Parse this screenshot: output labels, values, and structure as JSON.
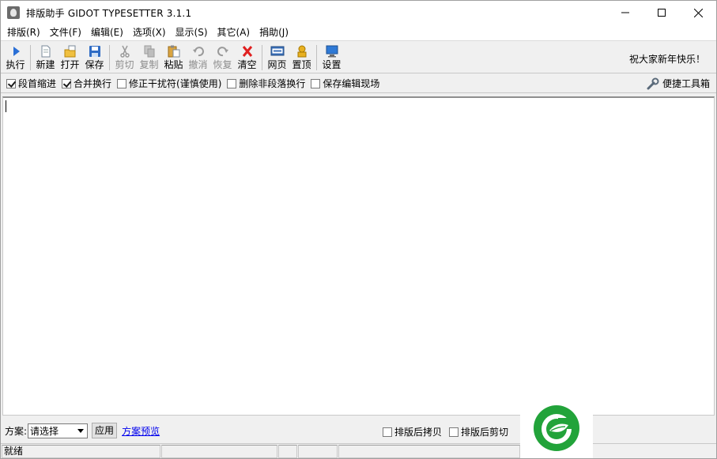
{
  "window": {
    "title": "排版助手 GIDOT TYPESETTER 3.1.1",
    "app_icon": "gidot-app-icon"
  },
  "controls": {
    "minimize": "minimize-icon",
    "maximize": "maximize-icon",
    "close": "close-icon"
  },
  "menu": [
    {
      "label": "排版(R)"
    },
    {
      "label": "文件(F)"
    },
    {
      "label": "编辑(E)"
    },
    {
      "label": "选项(X)"
    },
    {
      "label": "显示(S)"
    },
    {
      "label": "其它(A)"
    },
    {
      "label": "捐助(J)"
    }
  ],
  "toolbar": {
    "buttons": [
      {
        "label": "执行",
        "icon": "play-icon",
        "enabled": true
      },
      {
        "label": "新建",
        "icon": "new-file-icon",
        "enabled": true
      },
      {
        "label": "打开",
        "icon": "open-folder-icon",
        "enabled": true
      },
      {
        "label": "保存",
        "icon": "floppy-disk-icon",
        "enabled": true
      },
      {
        "label": "剪切",
        "icon": "scissors-icon",
        "enabled": false
      },
      {
        "label": "复制",
        "icon": "copy-icon",
        "enabled": false
      },
      {
        "label": "粘贴",
        "icon": "paste-icon",
        "enabled": true
      },
      {
        "label": "撤消",
        "icon": "undo-icon",
        "enabled": false
      },
      {
        "label": "恢复",
        "icon": "redo-icon",
        "enabled": false
      },
      {
        "label": "清空",
        "icon": "red-x-icon",
        "enabled": true
      },
      {
        "label": "网页",
        "icon": "html-icon",
        "enabled": true
      },
      {
        "label": "置顶",
        "icon": "pin-top-icon",
        "enabled": true
      },
      {
        "label": "设置",
        "icon": "monitor-settings-icon",
        "enabled": true
      }
    ],
    "greeting": "祝大家新年快乐！"
  },
  "options": {
    "items": [
      {
        "label": "段首缩进",
        "checked": true
      },
      {
        "label": "合并换行",
        "checked": true
      },
      {
        "label": "修正干扰符(谨慎使用)",
        "checked": false
      },
      {
        "label": "删除非段落换行",
        "checked": false
      },
      {
        "label": "保存编辑现场",
        "checked": false
      }
    ],
    "toolbox_label": "便捷工具箱",
    "toolbox_icon": "wrench-icon"
  },
  "scheme": {
    "label": "方案:",
    "selected": "请选择",
    "apply_label": "应用",
    "preview_label": "方案预览",
    "post_options": [
      {
        "label": "排版后拷贝",
        "checked": false
      },
      {
        "label": "排版后剪切",
        "checked": false
      }
    ]
  },
  "status": {
    "text": "就绪"
  },
  "colors": {
    "logo_green": "#22a33a",
    "link_blue": "#0000ee"
  }
}
